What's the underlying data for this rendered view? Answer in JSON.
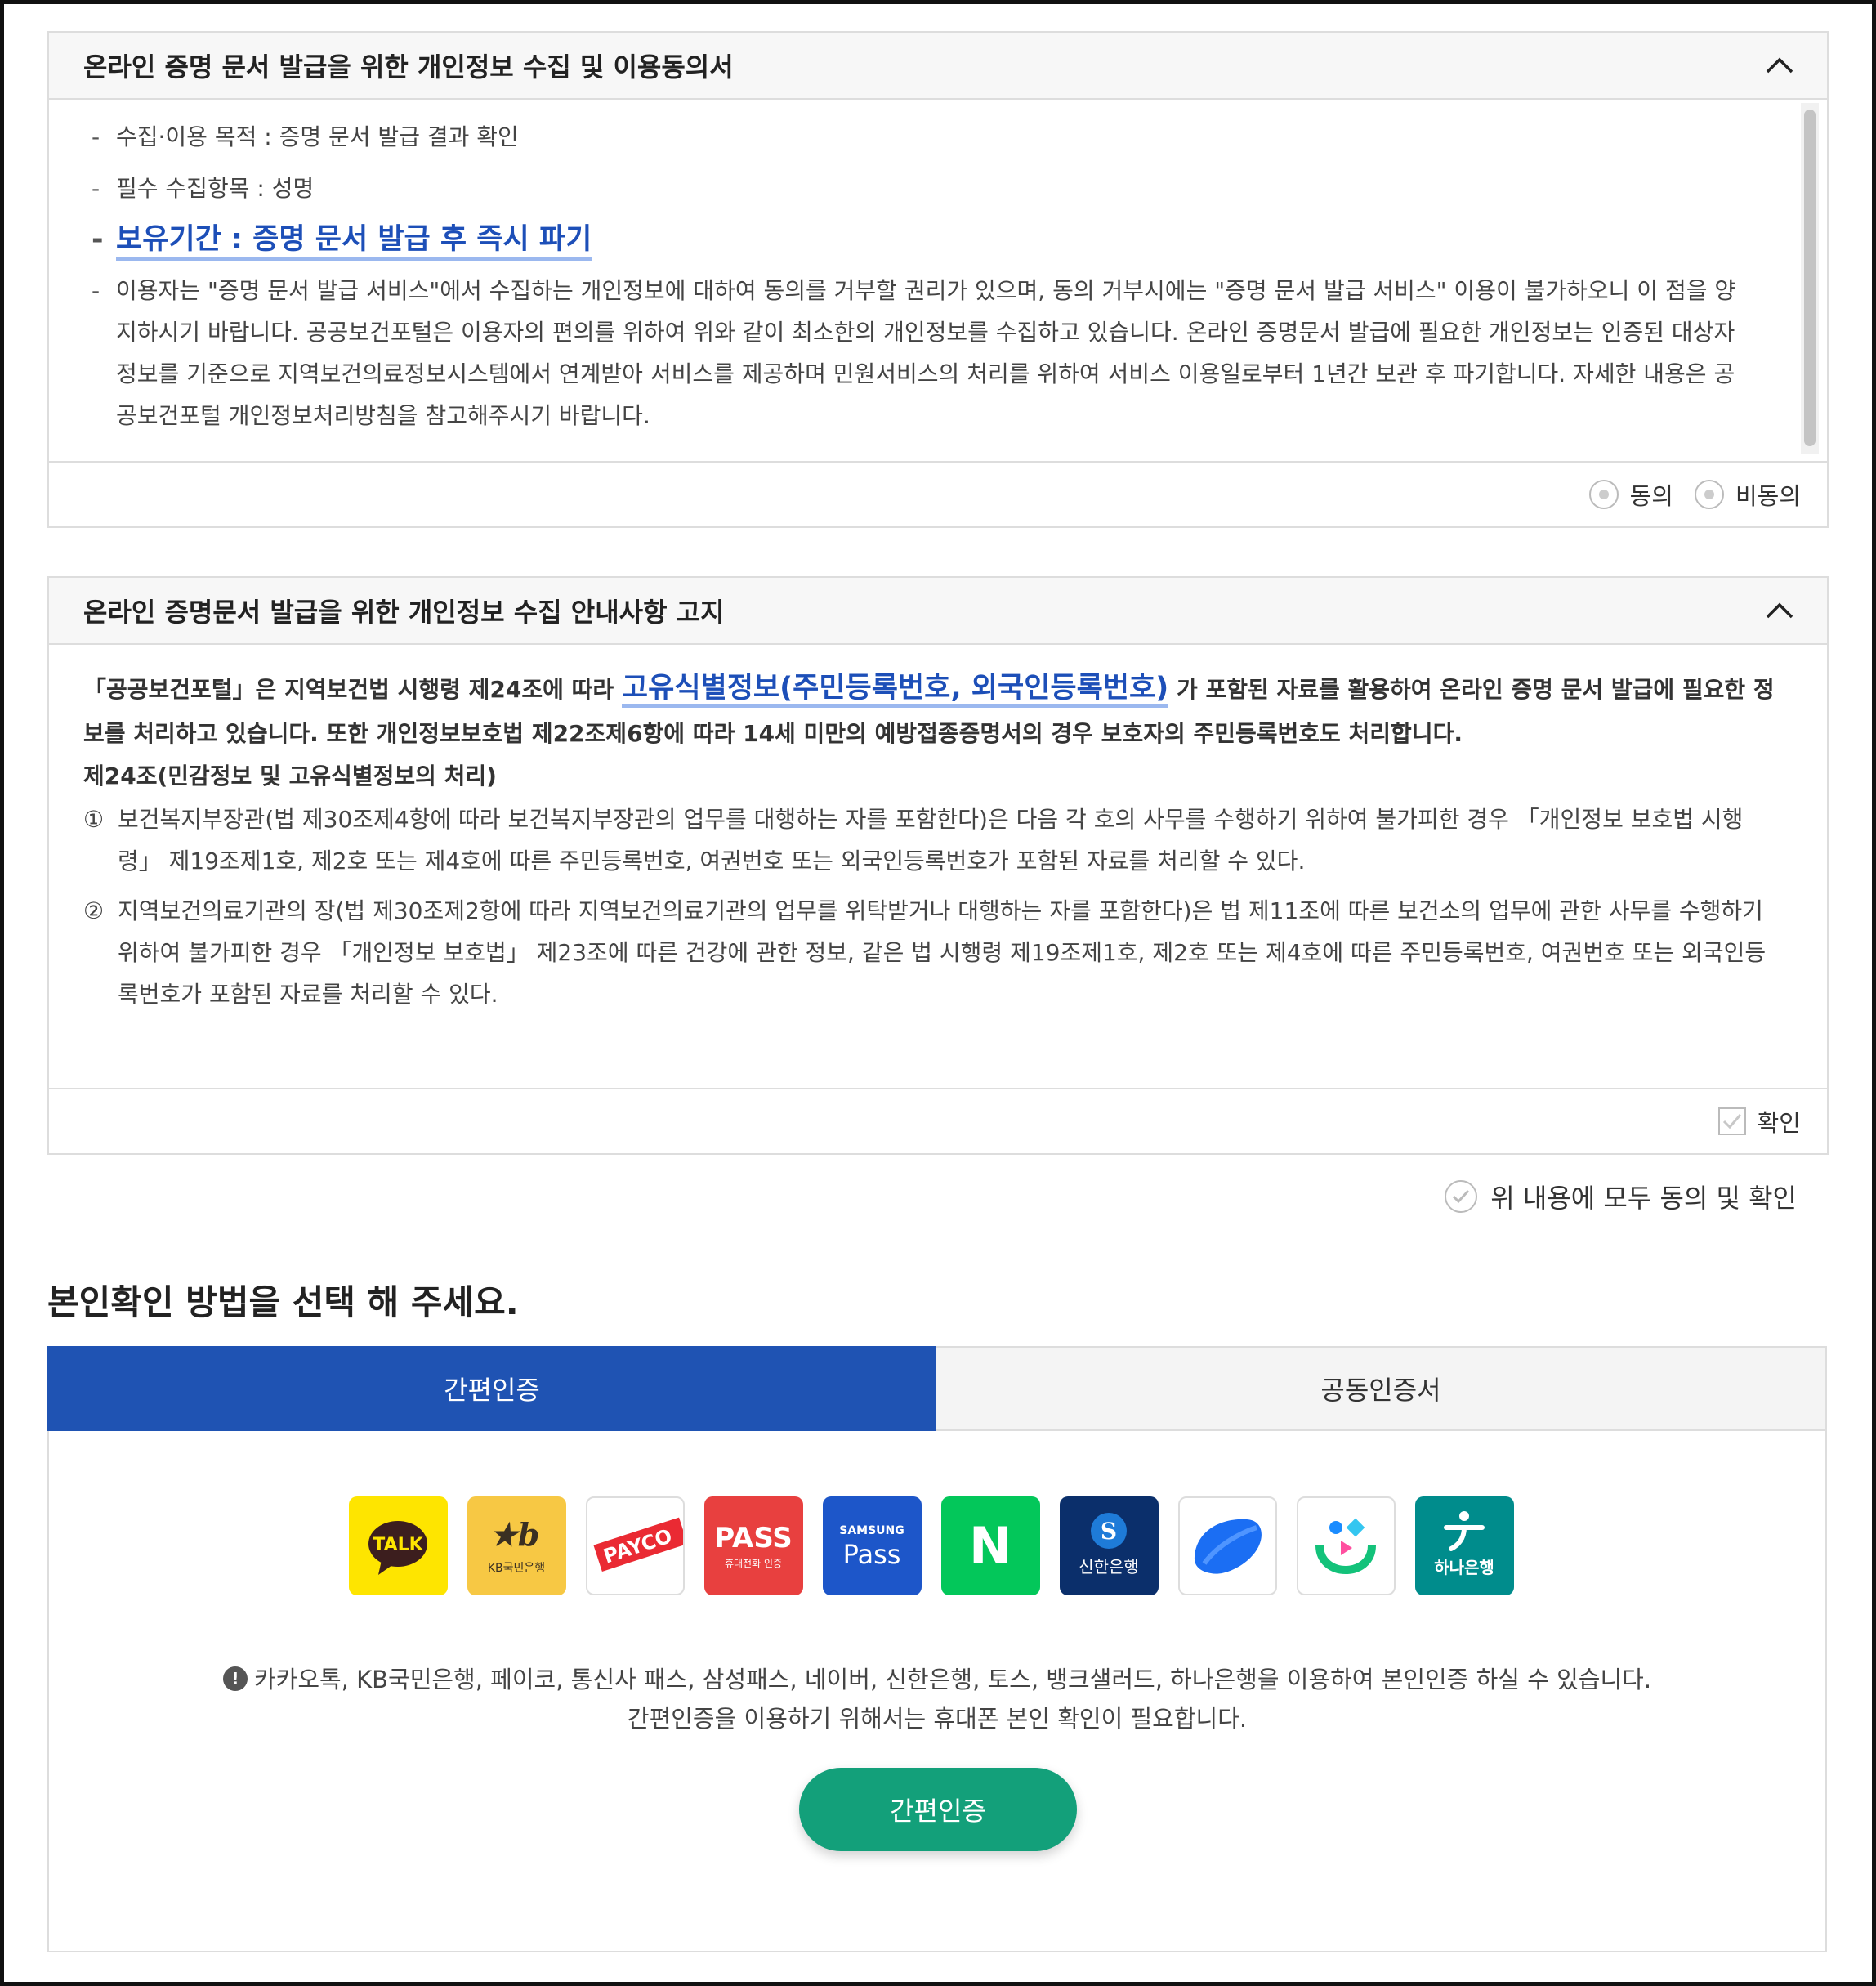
{
  "consent": {
    "title": "온라인 증명 문서 발급을 위한 개인정보 수집 및 이용동의서",
    "items": [
      "수집·이용 목적 : 증명 문서 발급 결과 확인",
      "필수 수집항목 : 성명",
      "보유기간 : 증명 문서 발급 후 즉시 파기",
      "이용자는 \"증명 문서 발급 서비스\"에서 수집하는 개인정보에 대하여 동의를 거부할 권리가 있으며, 동의 거부시에는 \"증명 문서 발급 서비스\" 이용이 불가하오니 이 점을 양지하시기 바랍니다. 공공보건포털은 이용자의 편의를 위하여 위와 같이 최소한의 개인정보를 수집하고 있습니다. 온라인 증명문서 발급에 필요한 개인정보는 인증된 대상자 정보를 기준으로 지역보건의료정보시스템에서 연계받아 서비스를 제공하며 민원서비스의 처리를 위하여 서비스 이용일로부터 1년간 보관 후 파기합니다. 자세한 내용은 공공보건포털 개인정보처리방침을 참고해주시기 바랍니다."
    ],
    "agree_label": "동의",
    "disagree_label": "비동의"
  },
  "notice_panel": {
    "title": "온라인 증명문서 발급을 위한 개인정보 수집 안내사항 고지",
    "lead_pre": "「공공보건포털」은 지역보건법 시행령 제24조에 따라 ",
    "lead_key": "고유식별정보(주민등록번호, 외국인등록번호)",
    "lead_post": " 가 포함된 자료를 활용하여 온라인 증명 문서 발급에 필요한 정보를 처리하고 있습니다. 또한 개인정보보호법 제22조제6항에 따라 14세 미만의 예방접종증명서의 경우 보호자의 주민등록번호도 처리합니다.",
    "article": "제24조(민감정보 및 고유식별정보의 처리)",
    "clauses": [
      {
        "num": "①",
        "text": "보건복지부장관(법 제30조제4항에 따라 보건복지부장관의 업무를 대행하는 자를 포함한다)은 다음 각 호의 사무를 수행하기 위하여 불가피한 경우 「개인정보 보호법 시행령」 제19조제1호, 제2호 또는 제4호에 따른 주민등록번호, 여권번호 또는 외국인등록번호가 포함된 자료를 처리할 수 있다."
      },
      {
        "num": "②",
        "text": "지역보건의료기관의 장(법 제30조제2항에 따라 지역보건의료기관의 업무를 위탁받거나 대행하는 자를 포함한다)은 법 제11조에 따른 보건소의 업무에 관한 사무를 수행하기 위하여 불가피한 경우 「개인정보 보호법」 제23조에 따른 건강에 관한 정보, 같은 법 시행령 제19조제1호, 제2호 또는 제4호에 따른 주민등록번호, 여권번호 또는 외국인등록번호가 포함된 자료를 처리할 수 있다."
      }
    ],
    "confirm_label": "확인"
  },
  "all_agree_label": "위 내용에 모두 동의 및 확인",
  "section_title": "본인확인 방법을 선택 해 주세요.",
  "tabs": [
    {
      "label": "간편인증",
      "active": true
    },
    {
      "label": "공동인증서",
      "active": false
    }
  ],
  "providers": {
    "kakao": "TALK",
    "kb_sub": "KB국민은행",
    "payco": "PAYCO",
    "pass_main": "PASS",
    "pass_sub": "휴대전화 인증",
    "samsung_top": "SAMSUNG",
    "samsung_main": "Pass",
    "naver": "N",
    "shinhan": "신한은행",
    "hana": "하나은행"
  },
  "colors": {
    "primary_blue": "#1f53b3",
    "auth_button_green": "#13a07a",
    "highlight_text": "#1d4fb8"
  },
  "notice_lines": [
    "카카오톡, KB국민은행, 페이코, 통신사 패스, 삼성패스, 네이버, 신한은행, 토스, 뱅크샐러드, 하나은행을 이용하여 본인인증 하실 수 있습니다.",
    "간편인증을 이용하기 위해서는 휴대폰 본인 확인이 필요합니다."
  ],
  "auth_button_label": "간편인증"
}
